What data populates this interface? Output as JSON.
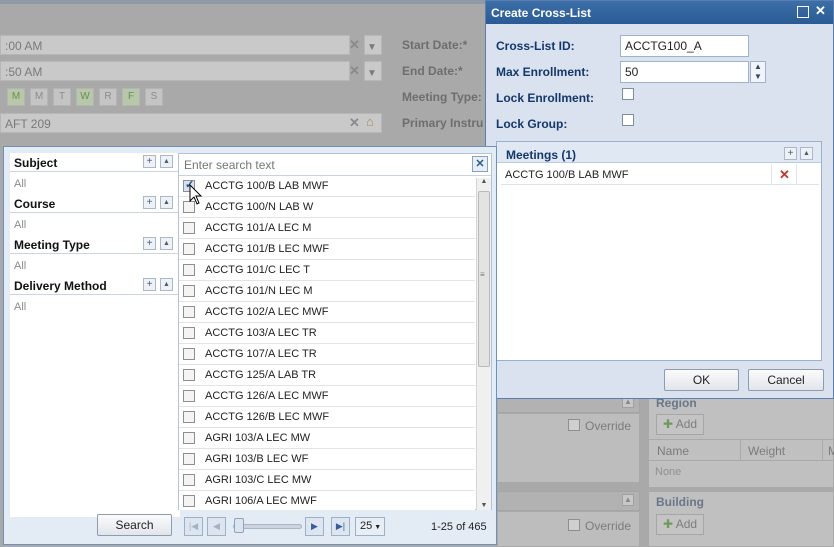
{
  "background_form": {
    "start_time": ":00 AM",
    "end_time": ":50 AM",
    "days": [
      {
        "label": "M",
        "on": true
      },
      {
        "label": "M",
        "on": false
      },
      {
        "label": "T",
        "on": false
      },
      {
        "label": "W",
        "on": true
      },
      {
        "label": "R",
        "on": false
      },
      {
        "label": "F",
        "on": true
      },
      {
        "label": "S",
        "on": false
      }
    ],
    "location": "AFT 209",
    "start_date_label": "Start Date:*",
    "end_date_label": "End Date:*",
    "meeting_type_label": "Meeting Type:",
    "primary_instructor_label": "Primary Instru",
    "override_label": "Override",
    "region_title": "Region",
    "building_title": "Building",
    "add_label": "Add",
    "name_col": "Name",
    "weight_col": "Weight",
    "m_col": "M",
    "none_text": "None"
  },
  "dialog": {
    "title": "Create Cross-List",
    "crosslist_id_label": "Cross-List ID:",
    "crosslist_id_value": "ACCTG100_A",
    "max_enrollment_label": "Max Enrollment:",
    "max_enrollment_value": "50",
    "lock_enrollment_label": "Lock Enrollment:",
    "lock_group_label": "Lock Group:",
    "meetings_title": "Meetings (1)",
    "meetings": [
      "ACCTG 100/B LAB MWF"
    ],
    "ok_label": "OK",
    "cancel_label": "Cancel"
  },
  "search_popup": {
    "filters": [
      {
        "title": "Subject",
        "value": "All"
      },
      {
        "title": "Course",
        "value": "All"
      },
      {
        "title": "Meeting Type",
        "value": "All"
      },
      {
        "title": "Delivery Method",
        "value": "All"
      }
    ],
    "search_placeholder": "Enter search text",
    "results": [
      {
        "label": "ACCTG 100/B LAB MWF",
        "checked": true
      },
      {
        "label": "ACCTG 100/N LAB W",
        "checked": false
      },
      {
        "label": "ACCTG 101/A LEC M",
        "checked": false
      },
      {
        "label": "ACCTG 101/B LEC MWF",
        "checked": false
      },
      {
        "label": "ACCTG 101/C LEC T",
        "checked": false
      },
      {
        "label": "ACCTG 101/N LEC M",
        "checked": false
      },
      {
        "label": "ACCTG 102/A LEC MWF",
        "checked": false
      },
      {
        "label": "ACCTG 103/A LEC TR",
        "checked": false
      },
      {
        "label": "ACCTG 107/A LEC TR",
        "checked": false
      },
      {
        "label": "ACCTG 125/A LAB TR",
        "checked": false
      },
      {
        "label": "ACCTG 126/A LEC MWF",
        "checked": false
      },
      {
        "label": "ACCTG 126/B LEC MWF",
        "checked": false
      },
      {
        "label": "AGRI 103/A LEC MW",
        "checked": false
      },
      {
        "label": "AGRI 103/B LEC WF",
        "checked": false
      },
      {
        "label": "AGRI 103/C LEC MW",
        "checked": false
      },
      {
        "label": "AGRI 106/A LEC MWF",
        "checked": false
      }
    ],
    "search_button": "Search",
    "page_size": "25",
    "page_info": "1-25 of 465"
  },
  "colors": {
    "dialog_header": "#2f6199",
    "label_blue": "#15376b",
    "delete_red": "#c0392b"
  }
}
